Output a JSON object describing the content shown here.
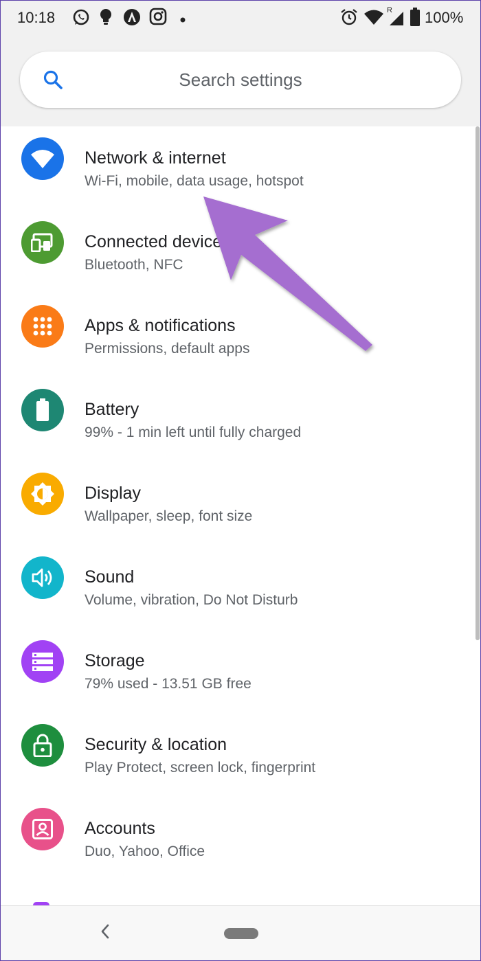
{
  "status_bar": {
    "time": "10:18",
    "battery_percent": "100%",
    "left_icons": [
      "whatsapp-icon",
      "bulb-icon",
      "arc-icon",
      "instagram-icon",
      "dot-icon"
    ],
    "right_icons": [
      "alarm-icon",
      "wifi-icon",
      "signal-icon",
      "battery-icon"
    ],
    "roaming_label": "R"
  },
  "search": {
    "placeholder": "Search settings",
    "icon": "search-icon",
    "accent": "#1a73e8"
  },
  "settings_items": [
    {
      "title": "Network & internet",
      "subtitle": "Wi-Fi, mobile, data usage, hotspot",
      "icon": "wifi-icon",
      "color": "#1a73e8"
    },
    {
      "title": "Connected devices",
      "subtitle": "Bluetooth, NFC",
      "icon": "devices-icon",
      "color": "#4d9b32"
    },
    {
      "title": "Apps & notifications",
      "subtitle": "Permissions, default apps",
      "icon": "apps-grid-icon",
      "color": "#fa7b17"
    },
    {
      "title": "Battery",
      "subtitle": "99% - 1 min left until fully charged",
      "icon": "battery-icon",
      "color": "#1e8773"
    },
    {
      "title": "Display",
      "subtitle": "Wallpaper, sleep, font size",
      "icon": "brightness-icon",
      "color": "#f9ab00"
    },
    {
      "title": "Sound",
      "subtitle": "Volume, vibration, Do Not Disturb",
      "icon": "volume-icon",
      "color": "#12b5cb"
    },
    {
      "title": "Storage",
      "subtitle": "79% used - 13.51 GB free",
      "icon": "storage-icon",
      "color": "#a142f4"
    },
    {
      "title": "Security & location",
      "subtitle": "Play Protect, screen lock, fingerprint",
      "icon": "lock-icon",
      "color": "#1e8e3e"
    },
    {
      "title": "Accounts",
      "subtitle": "Duo, Yahoo, Office",
      "icon": "account-box-icon",
      "color": "#e8518a"
    }
  ],
  "nav_bar": {
    "back_icon": "back-chevron-icon",
    "home_icon": "home-pill-icon"
  },
  "annotation": {
    "arrow_color": "#a56ed0"
  }
}
